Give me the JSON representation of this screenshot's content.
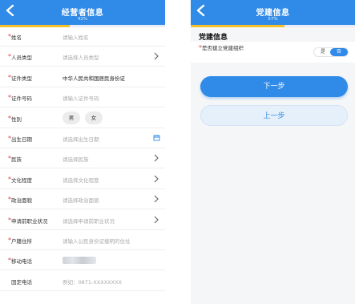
{
  "left_screen": {
    "title": "经营者信息",
    "progress_text": "42%",
    "progress_value": 0.42,
    "fields": [
      {
        "label": "姓名",
        "required": true,
        "value": "请输入姓名",
        "filled": false,
        "control": "text"
      },
      {
        "label": "人员类型",
        "required": true,
        "value": "请选择人员类型",
        "filled": false,
        "control": "select"
      },
      {
        "label": "证件类型",
        "required": true,
        "value": "中华人民共和国居民身份证",
        "filled": true,
        "control": "text"
      },
      {
        "label": "证件号码",
        "required": true,
        "value": "请输入证件号码",
        "filled": false,
        "control": "text"
      },
      {
        "label": "性别",
        "required": true,
        "control": "chips",
        "options": [
          "男",
          "女"
        ]
      },
      {
        "label": "出生日期",
        "required": true,
        "value": "请选择出生日期",
        "filled": false,
        "control": "date"
      },
      {
        "label": "民族",
        "required": true,
        "value": "请选择民族",
        "filled": false,
        "control": "select"
      },
      {
        "label": "文化程度",
        "required": true,
        "value": "请选择文化程度",
        "filled": false,
        "control": "select"
      },
      {
        "label": "政治面貌",
        "required": true,
        "value": "请选择政治面貌",
        "filled": false,
        "control": "select"
      },
      {
        "label": "申请前职业状况",
        "required": true,
        "value": "请选择申请前职业状况",
        "filled": false,
        "control": "select"
      },
      {
        "label": "户籍住所",
        "required": true,
        "value": "请输入公民身份证载明的住址",
        "filled": false,
        "control": "text"
      },
      {
        "label": "移动电话",
        "required": true,
        "control": "blurred"
      },
      {
        "label": "固定电话",
        "required": false,
        "value": "例如：0871-XXXXXXXX",
        "filled": false,
        "control": "text"
      }
    ]
  },
  "right_screen": {
    "title": "党建信息",
    "progress_text": "57%",
    "progress_value": 0.57,
    "section_title": "党建信息",
    "party_field": {
      "label": "是否建立党建组织",
      "required": true,
      "options": [
        "是",
        "否"
      ],
      "selected": "否"
    },
    "next_button": "下一步",
    "prev_button": "上一步"
  },
  "colors": {
    "primary": "#2f8ae8",
    "progress": "#f3c12a",
    "required": "#e23b3b"
  },
  "icons": {
    "back": "chevron-left-icon",
    "select": "chevron-right-icon",
    "date": "calendar-icon"
  }
}
